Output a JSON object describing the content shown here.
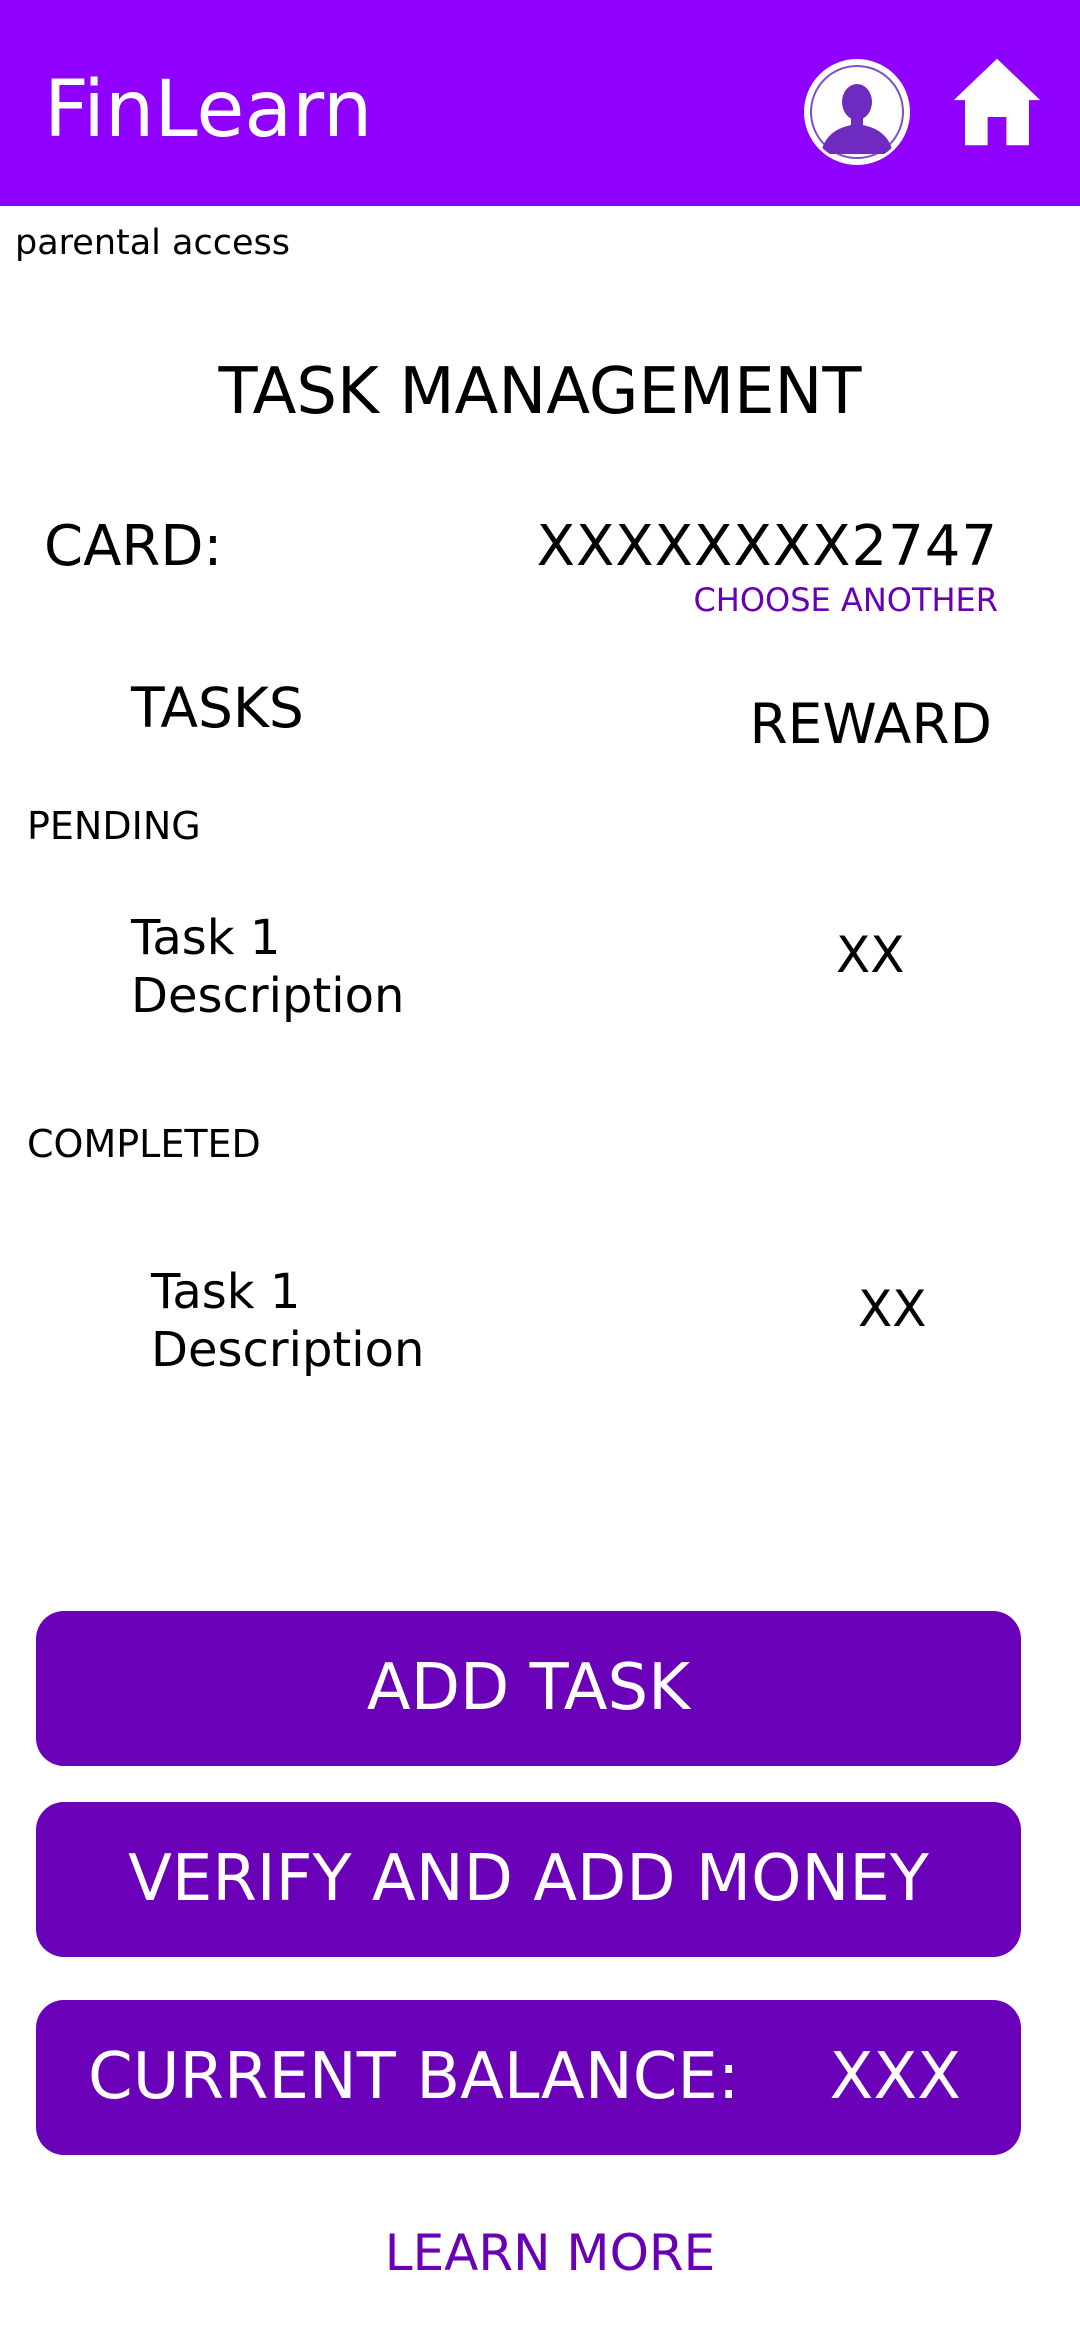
{
  "header": {
    "app_title": "FinLearn",
    "accent_color": "#8f00ff",
    "avatar_icon": "user-avatar-icon",
    "home_icon": "home-icon"
  },
  "parental_access": "parental access",
  "page_title": "TASK MANAGEMENT",
  "card": {
    "label": "CARD:",
    "number": "XXXXXXXX2747",
    "choose_another": "CHOOSE ANOTHER"
  },
  "columns": {
    "tasks": "TASKS",
    "reward": "REWARD"
  },
  "pending": {
    "label": "PENDING",
    "tasks": [
      {
        "description": "Task 1\nDescription",
        "reward": "XX"
      }
    ]
  },
  "completed": {
    "label": "COMPLETED",
    "tasks": [
      {
        "description": "Task 1\nDescription",
        "reward": "XX"
      }
    ]
  },
  "actions": {
    "add_task": "ADD TASK",
    "verify_add_money": "VERIFY AND ADD MONEY",
    "balance_label": "CURRENT BALANCE:",
    "balance_value": "XXX",
    "button_color": "#6a00b8"
  },
  "learn_more": "LEARN MORE"
}
